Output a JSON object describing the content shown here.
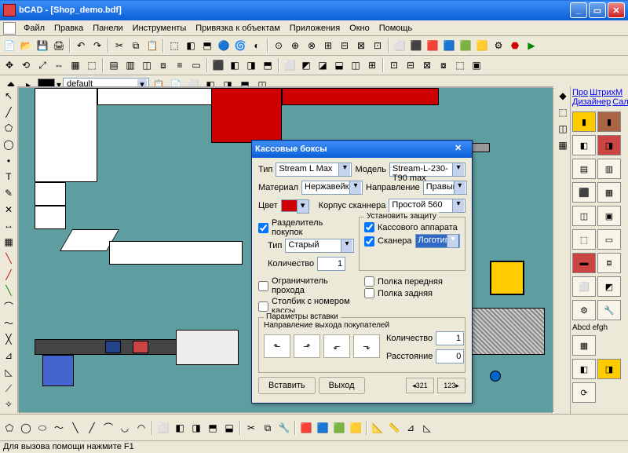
{
  "title": "bCAD - [Shop_demo.bdf]",
  "menu": [
    "Файл",
    "Правка",
    "Панели",
    "Инструменты",
    "Привязка к объектам",
    "Приложения",
    "Окно",
    "Помощь"
  ],
  "layerDropdown": "default",
  "rightLinks": [
    "Про",
    "ШтрихМ",
    "Дизайнер",
    "Салон"
  ],
  "rightText": "Abcd efgh",
  "status": "Для вызова помощи нажмите F1",
  "dlg": {
    "title": "Кассовые боксы",
    "type_lbl": "Тип",
    "type_val": "Stream L Max",
    "model_lbl": "Модель",
    "model_val": "Stream-L-230-T90 max",
    "material_lbl": "Материал",
    "material_val": "Нержавейка",
    "direction_lbl": "Направление",
    "direction_val": "Правый",
    "color_lbl": "Цвет",
    "scanner_lbl": "Корпус сканнера",
    "scanner_val": "Простой 560",
    "divider_chk": "Разделитель покупок",
    "divider_type_lbl": "Тип",
    "divider_type_val": "Старый",
    "qty_lbl": "Количество",
    "qty_val": "1",
    "protect_legend": "Установить защиту",
    "protect_cash": "Кассового аппарата",
    "protect_scanner": "Сканера",
    "protect_scanner_val": "Логотип",
    "limiter_chk": "Ограничитель прохода",
    "column_chk": "Столбик с номером кассы",
    "shelf_front": "Полка передняя",
    "shelf_back": "Полка задняя",
    "insert_legend": "Параметры вставки",
    "exit_dir_lbl": "Направление выхода покупателей",
    "ins_qty_lbl": "Количество",
    "ins_qty_val": "1",
    "dist_lbl": "Расстояние",
    "dist_val": "0",
    "btn_insert": "Вставить",
    "btn_exit": "Выход",
    "nav1": "◂321",
    "nav2": "123▸"
  }
}
